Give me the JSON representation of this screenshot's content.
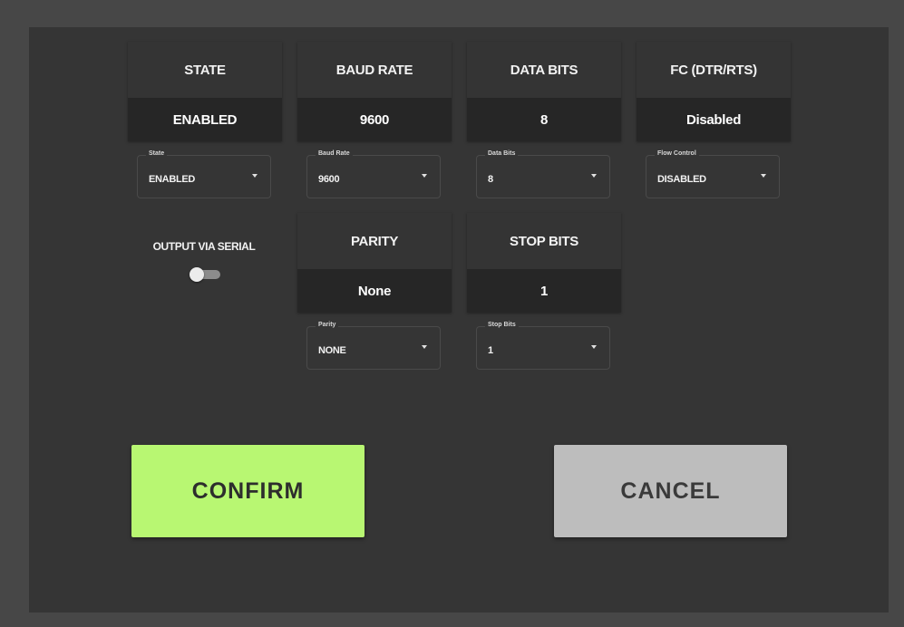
{
  "cards": {
    "state": {
      "title": "STATE",
      "value": "ENABLED"
    },
    "baud_rate": {
      "title": "BAUD RATE",
      "value": "9600"
    },
    "data_bits": {
      "title": "DATA BITS",
      "value": "8"
    },
    "flow_control": {
      "title": "FC (DTR/RTS)",
      "value": "Disabled"
    },
    "parity": {
      "title": "PARITY",
      "value": "None"
    },
    "stop_bits": {
      "title": "STOP BITS",
      "value": "1"
    }
  },
  "selects": {
    "state": {
      "label": "State",
      "value": "ENABLED"
    },
    "baud_rate": {
      "label": "Baud Rate",
      "value": "9600"
    },
    "data_bits": {
      "label": "Data Bits",
      "value": "8"
    },
    "flow_control": {
      "label": "Flow Control",
      "value": "DISABLED"
    },
    "parity": {
      "label": "Parity",
      "value": "NONE"
    },
    "stop_bits": {
      "label": "Stop Bits",
      "value": "1"
    }
  },
  "output_serial": {
    "label": "OUTPUT VIA SERIAL",
    "enabled": false
  },
  "buttons": {
    "confirm": "CONFIRM",
    "cancel": "CANCEL"
  },
  "colors": {
    "confirm": "#b8f772",
    "cancel": "#bdbdbd",
    "background": "#353535"
  }
}
